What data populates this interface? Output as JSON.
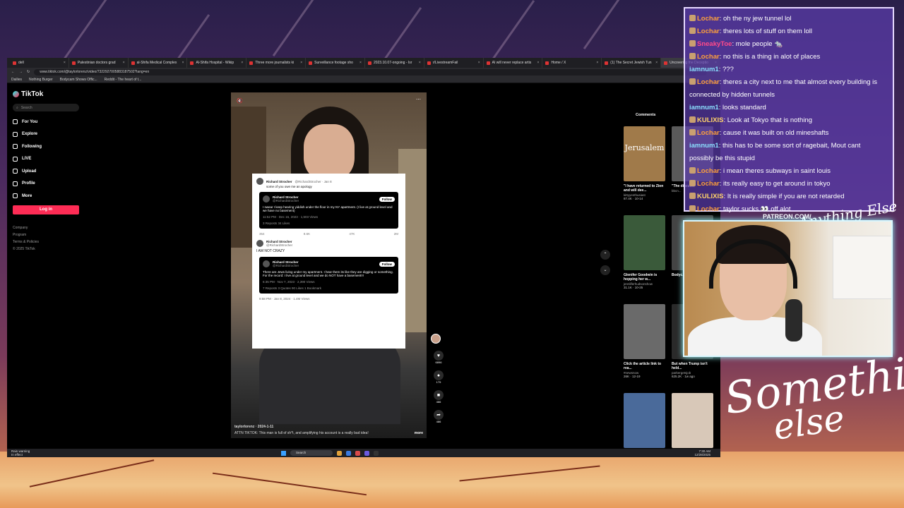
{
  "browser": {
    "tabs": [
      {
        "label": "dell",
        "active": false
      },
      {
        "label": "Palestinian doctors grad",
        "active": false
      },
      {
        "label": "al-Shifa Medical Complex",
        "active": false
      },
      {
        "label": "Al-Shifa Hospital - Wikip",
        "active": false
      },
      {
        "label": "Three more journalists ki",
        "active": false
      },
      {
        "label": "Surveillance footage sho",
        "active": false
      },
      {
        "label": "2023.10.07-ongoing - Isr",
        "active": false
      },
      {
        "label": "r/LivestreamFail",
        "active": false
      },
      {
        "label": "AI will never replace artis",
        "active": false
      },
      {
        "label": "Home / X",
        "active": false
      },
      {
        "label": "(1) The Secret Jewish Tun",
        "active": false
      },
      {
        "label": "Uncovering the Deceptio",
        "active": true
      }
    ],
    "url": "www.tiktok.com/@taylorlorenz/video/7322927005883187502?lang=en",
    "bookmarks": [
      "Dailies",
      "Nothing Burger",
      "Bodycam Shows Offic...",
      "Reddit - The heart of t..."
    ]
  },
  "tiktok": {
    "logo": "TikTok",
    "search_placeholder": "Search",
    "nav": [
      "For You",
      "Explore",
      "Following",
      "LIVE",
      "Upload",
      "Profile",
      "More"
    ],
    "login": "Log in",
    "footer": [
      "Company",
      "Program",
      "Terms & Policies",
      "© 2025 TikTok"
    ],
    "comments_tab": "Comments",
    "video": {
      "username": "taylorlorenz",
      "date": "2024-1-11",
      "caption": "ATTN TIKTOK: This man is full of sh*t, and amplifying his account is a really bad idea!",
      "more": "more"
    },
    "actions": [
      {
        "icon": "heart-icon",
        "glyph": "♥",
        "count": "6896"
      },
      {
        "icon": "comment-icon",
        "glyph": "●",
        "count": "179"
      },
      {
        "icon": "bookmark-icon",
        "glyph": "■",
        "count": "466"
      },
      {
        "icon": "share-icon",
        "glyph": "➦",
        "count": "486"
      }
    ],
    "tweet": {
      "name": "Richard Strocher",
      "handle": "@RichardStrocher · Jan 8",
      "text": "some of you owe me an apology",
      "embed1": {
        "name": "Richard Strocher",
        "handle": "@RichardStrocher",
        "follow": "Follow",
        "text": "I swear I keep hearing yiddish under the floor in my NY apartment. (I live at ground level and we have no basement)",
        "meta": "11:52 PM · Dec 16, 2023 · 1,503 Views",
        "stats": "3 Reposts   34 Likes"
      },
      "actions": [
        "354",
        "8.6K",
        "47K",
        "2M"
      ],
      "reply": {
        "name": "Richard Strocher",
        "handle": "@RichardStrocher",
        "text": "I AM NOT CRAZY"
      },
      "embed2": {
        "name": "Richard Strocher",
        "handle": "@RichardStrocher",
        "follow": "Follow",
        "text": "There are Jews living under my apartment. I hear them its like they are digging or something. For the record: I live at ground level and we do NOT have a basement!!!",
        "meta": "6:35 PM · Nov 7, 2023 · 2,390 Views",
        "stats": "7 Reposts   3 Quotes   90 Likes   1 Bookmark"
      },
      "footer": "9:58 PM · Jan 8, 2024 · 1.4M Views"
    },
    "suggestions": [
      {
        "title": "\"I have returned to Zion and will dee...",
        "author": "kittyyenthusiast",
        "stats": "87.4K · 10-14",
        "color": "#a07a4a"
      },
      {
        "title": "\"The discus...",
        "author": "bbcn...",
        "stats": "",
        "color": "#5a5a5a"
      },
      {
        "title": "Glenifer Goodwin is hopping her w...",
        "author": "jennliferhudsonshow",
        "stats": "31.1K · 10-25",
        "color": "#3a5a3a"
      },
      {
        "title": "Bodyc... show...",
        "author": "",
        "stats": "",
        "color": "#444"
      },
      {
        "title": "Click the article link to rea...",
        "author": "#newsnow",
        "stats": "26K · 12-19",
        "color": "#6a6a6a"
      },
      {
        "title": "But when Trump isn't held...",
        "author": "parkergetsjob",
        "stats": "625.2K · 1w ago",
        "color": "#2a2a2a"
      },
      {
        "title": "",
        "author": "",
        "stats": "",
        "color": "#4a6a9a"
      },
      {
        "title": "",
        "author": "",
        "stats": "",
        "color": "#d8c8b8"
      }
    ],
    "thumb_overlay": "Jerusalem"
  },
  "taskbar": {
    "weather_line1": "Rain warning",
    "weather_line2": "In effect",
    "search": "Search",
    "time": "7:30 AM",
    "date": "12/28/2025"
  },
  "chat": [
    {
      "user": "Lochar",
      "color": "#ffa13b",
      "text": "oh the ny jew tunnel lol",
      "badge": true
    },
    {
      "user": "Lochar",
      "color": "#ffa13b",
      "text": "theres lots of stuff on them loll",
      "badge": true
    },
    {
      "user": "SneakyToe",
      "color": "#ff4a8a",
      "text": "mole people 🐀",
      "badge": true
    },
    {
      "user": "Lochar",
      "color": "#ffa13b",
      "text": "no this is a thing in alot of places",
      "badge": true
    },
    {
      "user": "iamnum1",
      "color": "#8be0ff",
      "text": "???",
      "badge": false
    },
    {
      "user": "Lochar",
      "color": "#ffa13b",
      "text": "theres a city next to me that almost every building is",
      "badge": true
    },
    {
      "user": "",
      "color": "#fff",
      "text": "connected by hidden tunnels",
      "badge": false
    },
    {
      "user": "iamnum1",
      "color": "#8be0ff",
      "text": "looks standard",
      "badge": false
    },
    {
      "user": "KULIXIS",
      "color": "#ffd36a",
      "text": "Look at Tokyo that is nothing",
      "badge": true
    },
    {
      "user": "Lochar",
      "color": "#ffa13b",
      "text": "cause it was built on old mineshafts",
      "badge": true
    },
    {
      "user": "iamnum1",
      "color": "#8be0ff",
      "text": "this has to be some sort of ragebait, Mout cant",
      "badge": false
    },
    {
      "user": "",
      "color": "#fff",
      "text": "possibly be this stupid",
      "badge": false
    },
    {
      "user": "Lochar",
      "color": "#ffa13b",
      "text": "i mean theres subways in saint louis",
      "badge": true
    },
    {
      "user": "Lochar",
      "color": "#ffa13b",
      "text": "its really easy to get around in tokyo",
      "badge": true
    },
    {
      "user": "KULIXIS",
      "color": "#ffd36a",
      "text": "It is really simple if you are not retarded",
      "badge": true
    },
    {
      "user": "Lochar",
      "color": "#ffa13b",
      "text": "taylor sucks 👀 off alot",
      "badge": true
    }
  ],
  "overlay": {
    "patreon": "PATREON.COM/",
    "brand_small": "Anything Else",
    "brand_large_1": "Something",
    "brand_large_2": "else"
  }
}
